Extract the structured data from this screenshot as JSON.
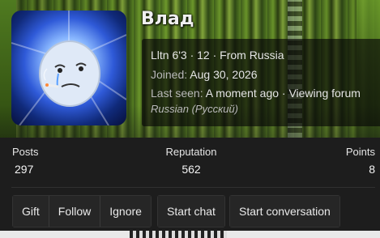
{
  "profile": {
    "username": "Влад",
    "line1": "Lltn 6'3 · 12 · From Russia",
    "joined_label": "Joined:",
    "joined_value": "Aug 30, 2026",
    "last_seen_label": "Last seen:",
    "last_seen_value": "A moment ago · Viewing forum",
    "language": "Russian (Русский)"
  },
  "stats": {
    "posts": {
      "label": "Posts",
      "value": "297"
    },
    "reputation": {
      "label": "Reputation",
      "value": "562"
    },
    "points": {
      "label": "Points",
      "value": "8"
    }
  },
  "actions": {
    "gift": "Gift",
    "follow": "Follow",
    "ignore": "Ignore",
    "start_chat": "Start chat",
    "start_conversation": "Start conversation"
  },
  "icons": {
    "avatar": "avatar-crying-face"
  }
}
